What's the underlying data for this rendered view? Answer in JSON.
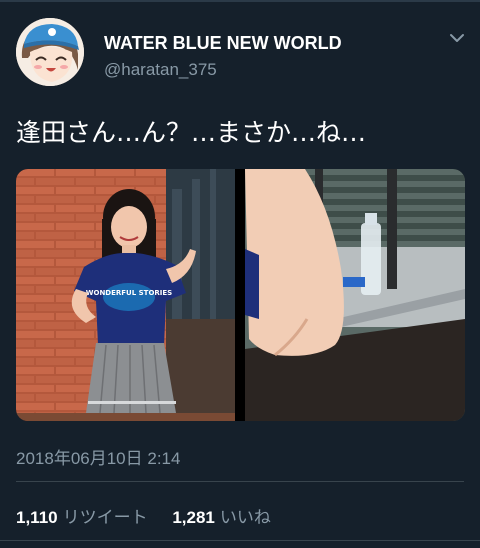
{
  "tweet": {
    "author_name": "WATER BLUE NEW WORLD",
    "author_handle": "@haratan_375",
    "text": "逢田さん…ん？…まさか…ね…",
    "timestamp": "2018年06月10日 2:14",
    "shirt_text": "WONDERFUL STORIES",
    "retweets": {
      "count": "1,110",
      "label": "リツイート"
    },
    "likes": {
      "count": "1,281",
      "label": "いいね"
    }
  },
  "icons": {
    "menu": "chevron-down-icon",
    "avatar": "anime-avatar"
  },
  "colors": {
    "background": "#15202b",
    "text_primary": "#ffffff",
    "text_secondary": "#8899a6",
    "divider": "#38444d"
  }
}
